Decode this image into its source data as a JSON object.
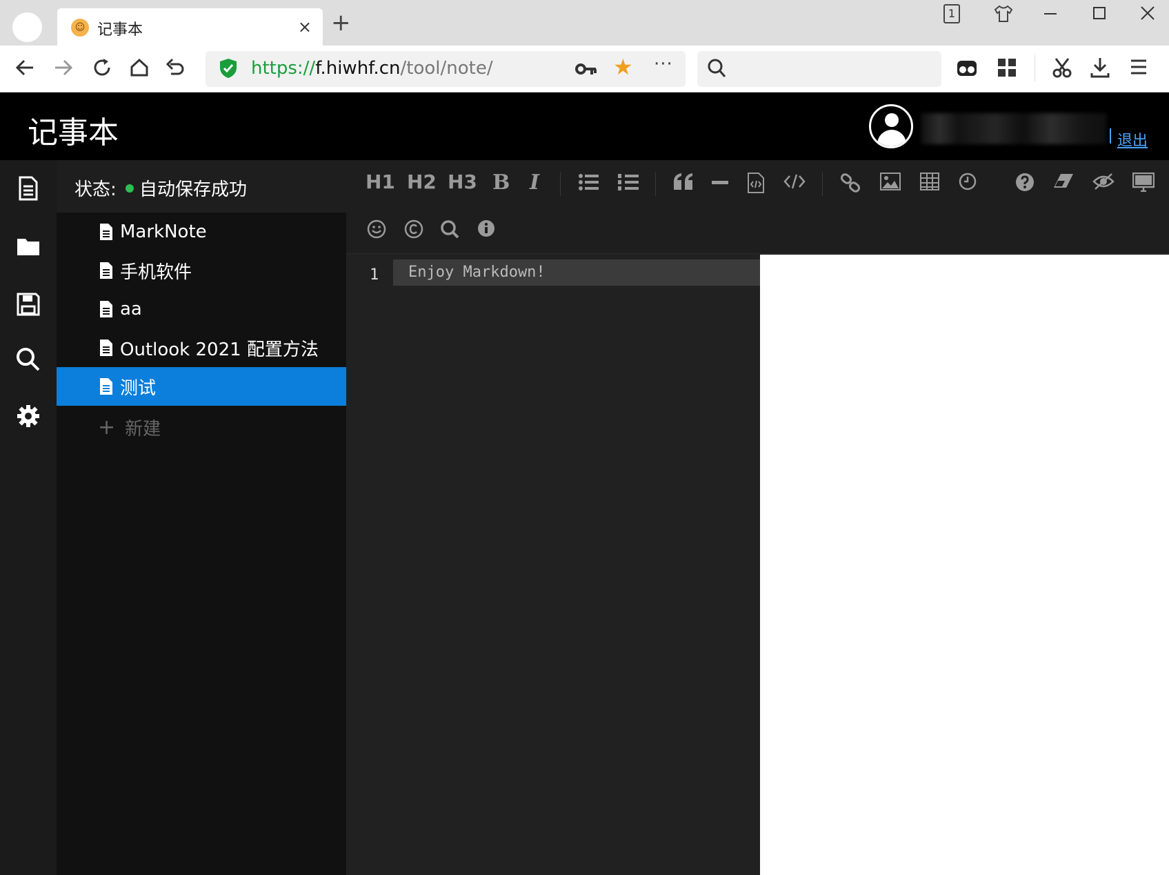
{
  "browser": {
    "tab_title": "记事本",
    "tab_close": "×",
    "new_tab": "+",
    "window_count": "1",
    "url_scheme": "https://",
    "url_host": "f.hiwhf.cn",
    "url_path": "/tool/note/",
    "more": "···",
    "search_placeholder": ""
  },
  "app": {
    "title": "记事本",
    "logout": "退出"
  },
  "status": {
    "label": "状态:",
    "text": "自动保存成功",
    "color": "#2dbf52"
  },
  "files": [
    {
      "name": "MarkNote",
      "active": false
    },
    {
      "name": "手机软件",
      "active": false
    },
    {
      "name": "aa",
      "active": false
    },
    {
      "name": "Outlook 2021 配置方法",
      "active": false
    },
    {
      "name": "测试",
      "active": true
    }
  ],
  "new_file": {
    "plus": "+",
    "label": "新建"
  },
  "toolbar": {
    "h1": "H1",
    "h2": "H2",
    "h3": "H3",
    "bold": "B",
    "italic": "I"
  },
  "editor": {
    "line_number": "1",
    "line_text": "Enjoy Markdown!"
  },
  "colors": {
    "accent": "#0b7fdb",
    "link": "#4aa3ff",
    "star": "#f0a020"
  }
}
